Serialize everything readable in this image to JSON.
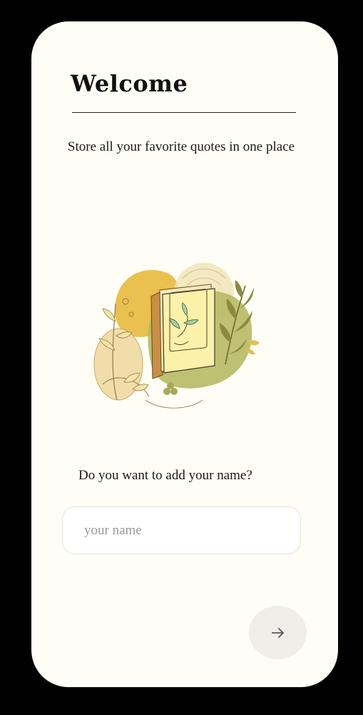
{
  "screen": {
    "title": "Welcome",
    "subtitle": "Store all your favorite quotes in one place",
    "illustration_icon": "book-with-leaves-illustration"
  },
  "name_form": {
    "prompt": "Do you want to add your name?",
    "input_placeholder": "your name",
    "input_value": "",
    "next_icon": "arrow-right-icon"
  },
  "colors": {
    "background": "#FFFEF6",
    "outer": "#000000",
    "accent_yellow": "#E9BD45",
    "accent_green": "#B6BA63",
    "button_bg": "#F0EEE8"
  }
}
